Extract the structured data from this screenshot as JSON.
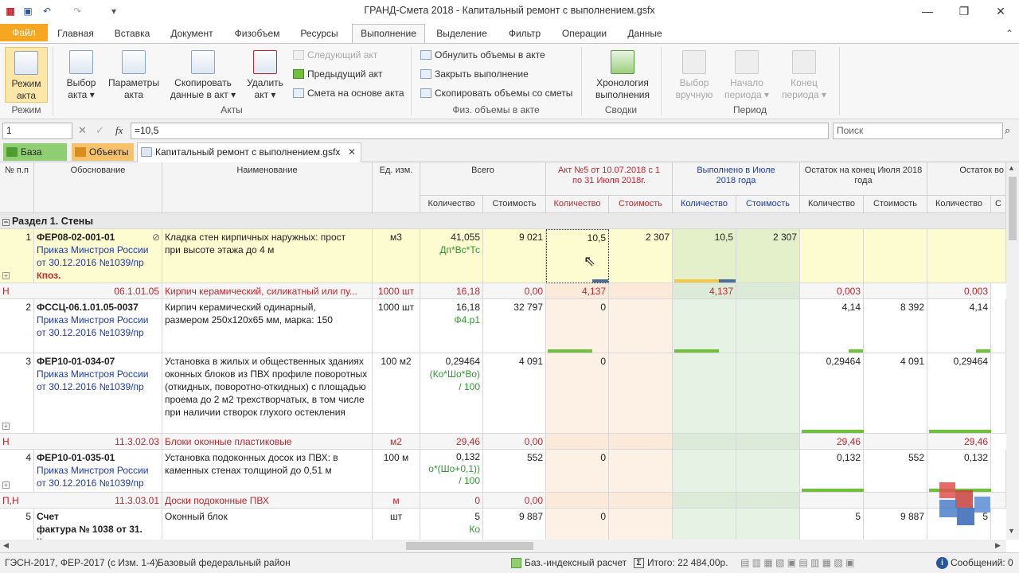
{
  "window": {
    "title": "ГРАНД-Смета 2018 - Капитальный ремонт с выполнением.gsfx"
  },
  "tabs": [
    "Файл",
    "Главная",
    "Вставка",
    "Документ",
    "Физобъем",
    "Ресурсы",
    "Выполнение",
    "Выделение",
    "Фильтр",
    "Операции",
    "Данные"
  ],
  "ribbon": {
    "mode": {
      "line1": "Режим",
      "line2": "акта",
      "group": "Режим"
    },
    "select_act": {
      "line1": "Выбор",
      "line2": "акта ▾"
    },
    "act_params": {
      "line1": "Параметры",
      "line2": "акта"
    },
    "copy_data": {
      "line1": "Скопировать",
      "line2": "данные в акт ▾"
    },
    "delete_act": {
      "line1": "Удалить",
      "line2": "акт ▾"
    },
    "next_act": "Следующий акт",
    "prev_act": "Предыдущий акт",
    "estimate_act": "Смета на основе акта",
    "acts_group": "Акты",
    "zero_volumes": "Обнулить объемы в акте",
    "close_exec": "Закрыть выполнение",
    "copy_volumes": "Скопировать объемы со сметы",
    "phys_group": "Физ. объемы в акте",
    "chrono": {
      "line1": "Хронология",
      "line2": "выполнения"
    },
    "reports_group": "Сводки",
    "manual": {
      "line1": "Выбор",
      "line2": "вручную"
    },
    "period_start": {
      "line1": "Начало",
      "line2": "периода ▾"
    },
    "period_end": {
      "line1": "Конец",
      "line2": "периода ▾"
    },
    "period_group": "Период"
  },
  "formula": {
    "cell_ref": "1",
    "value": "=10,5",
    "search_placeholder": "Поиск"
  },
  "doc_tabs": {
    "base": "База",
    "objects": "Объекты",
    "doc": "Капитальный ремонт с выполнением.gsfx"
  },
  "columns": {
    "num": "№ п.п",
    "basis": "Обоснование",
    "name": "Наименование",
    "unit": "Ед. изм.",
    "total": "Всего",
    "act": "Акт №5 от 10.07.2018 с 1 по 31 Июля 2018г.",
    "done": "Выполнено в Июле 2018 года",
    "rest": "Остаток на конец Июля 2018 года",
    "rest2": "Остаток во",
    "qty": "Количество",
    "cost": "Стоимость",
    "c": "С"
  },
  "section": "Раздел 1. Стены",
  "rows": {
    "r1": {
      "num": "1",
      "code": "ФЕР08-02-001-01",
      "order1": "Приказ Минстроя России",
      "order2": "от 30.12.2016 №1039/пр",
      "k": "К",
      "poz": "поз.",
      "name1": "Кладка стен кирпичных наружных: прост",
      "name2": "при высоте этажа до 4 м",
      "unit": "м3",
      "qty": "41,055",
      "formula": "Дп*Вс*Тс",
      "cost": "9 021",
      "act_qty": "10,5",
      "act_cost": "2 307",
      "done_qty": "10,5",
      "done_cost": "2 307"
    },
    "r1n": {
      "flag": "Н",
      "code": "06.1.01.05",
      "name": "Кирпич керамический, силикатный или пу...",
      "unit": "1000 шт",
      "qty": "16,18",
      "cost": "0,00",
      "act_qty": "4,137",
      "done_qty": "4,137",
      "rest_qty": "0,003",
      "rest2_qty": "0,003"
    },
    "r2": {
      "num": "2",
      "code": "ФССЦ-06.1.01.05-0037",
      "order1": "Приказ Минстроя России",
      "order2": "от 30.12.2016 №1039/пр",
      "name1": "Кирпич керамический одинарный,",
      "name2": "размером 250x120x65 мм, марка: 150",
      "unit": "1000 шт",
      "qty": "16,18",
      "formula": "Ф4.р1",
      "cost": "32 797",
      "act_qty": "0",
      "rest_qty": "4,14",
      "rest_cost": "8 392",
      "rest2_qty": "4,14"
    },
    "r3": {
      "num": "3",
      "code": "ФЕР10-01-034-07",
      "order1": "Приказ Минстроя России",
      "order2": "от 30.12.2016 №1039/пр",
      "name": "Установка в жилых и общественных зданиях оконных блоков из ПВХ профиле поворотных (откидных, поворотно-откидных) с площадью проема до 2 м2 трехстворчатых, в том числе при наличии створок глухого остекления",
      "unit": "100 м2",
      "qty": "0,29464",
      "formula1": "(Ко*Шо*Во)",
      "formula2": "/ 100",
      "cost": "4 091",
      "act_qty": "0",
      "rest_qty": "0,29464",
      "rest_cost": "4 091",
      "rest2_qty": "0,29464"
    },
    "r3n": {
      "flag": "Н",
      "code": "11.3.02.03",
      "name": "Блоки оконные пластиковые",
      "unit": "м2",
      "qty": "29,46",
      "cost": "0,00",
      "rest_qty": "29,46",
      "rest2_qty": "29,46"
    },
    "r4": {
      "num": "4",
      "code": "ФЕР10-01-035-01",
      "order1": "Приказ Минстроя России",
      "order2": "от 30.12.2016 №1039/пр",
      "name1": "Установка подоконных досок из ПВХ: в",
      "name2": "каменных стенах толщиной до 0,51 м",
      "unit": "100 м",
      "qty": "0,132",
      "formula1": "о*(Шо+0,1))",
      "formula2": "/ 100",
      "cost": "552",
      "act_qty": "0",
      "rest_qty": "0,132",
      "rest_cost": "552",
      "rest2_qty": "0,132"
    },
    "r4n": {
      "flag": "П,Н",
      "code": "11.3.03.01",
      "name": "Доски подоконные ПВХ",
      "unit": "м",
      "qty": "0",
      "cost": "0,00"
    },
    "r5": {
      "num": "5",
      "code1": "Счет",
      "code2": "фактура № 1038 от 31.",
      "k": "К",
      "name": "Оконный блок",
      "unit": "шт",
      "qty": "5",
      "formula": "Ко",
      "cost": "9 887",
      "act_qty": "0",
      "rest_qty": "5",
      "rest_cost": "9 887",
      "rest2_qty": "5"
    }
  },
  "status": {
    "norms": "ГЭСН-2017, ФЕР-2017 (с Изм. 1-4)",
    "region": "Базовый федеральный район",
    "calc": "Баз.-индексный расчет",
    "total": "Итого: 22 484,00р.",
    "messages": "Сообщений: 0"
  }
}
